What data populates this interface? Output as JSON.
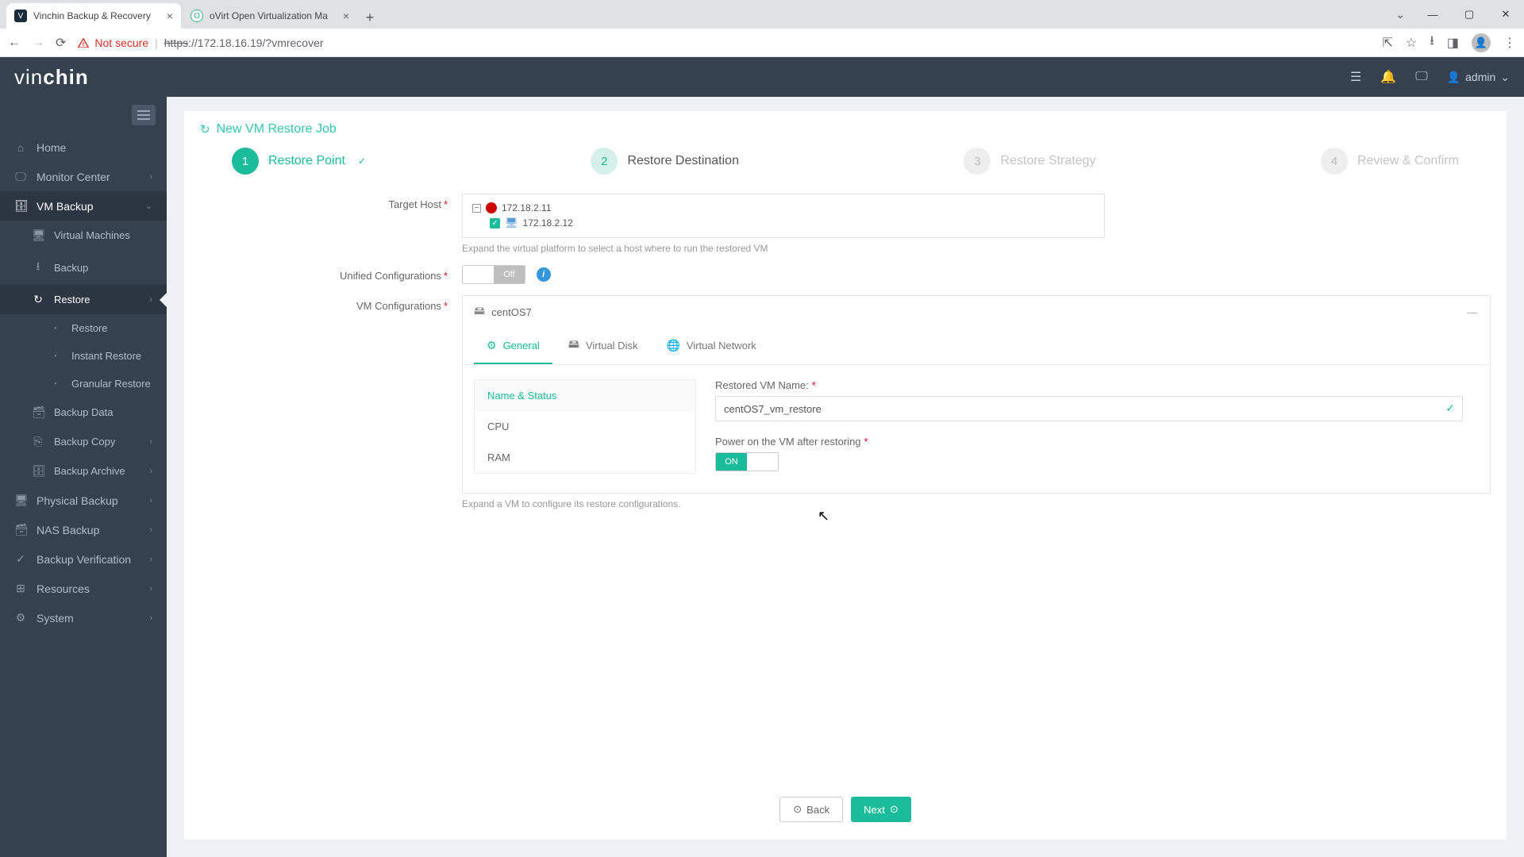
{
  "browser": {
    "tabs": [
      {
        "title": "Vinchin Backup & Recovery",
        "fav": "V",
        "active": true
      },
      {
        "title": "oVirt Open Virtualization Ma",
        "fav": "O",
        "active": false
      }
    ],
    "not_secure": "Not secure",
    "url_proto": "https",
    "url_rest": "://172.18.16.19/?vmrecover",
    "wc_min": "—",
    "wc_max": "▢",
    "wc_close": "✕",
    "wc_chev": "⌄"
  },
  "header": {
    "logo1": "vin",
    "logo2": "chin",
    "admin": "admin"
  },
  "sidebar": {
    "items": [
      {
        "icon": "⌂",
        "label": "Home"
      },
      {
        "icon": "🖵",
        "label": "Monitor Center",
        "chev": true
      },
      {
        "icon": "🗄",
        "label": "VM Backup",
        "chev": true,
        "open": true
      },
      {
        "icon": "",
        "label": "Virtual Machines",
        "lvl": 2
      },
      {
        "icon": "",
        "label": "Backup",
        "lvl": 2
      },
      {
        "icon": "",
        "label": "Restore",
        "lvl": 2,
        "chev": true,
        "active": true
      },
      {
        "icon": "",
        "label": "Restore",
        "lvl": 3
      },
      {
        "icon": "",
        "label": "Instant Restore",
        "lvl": 3
      },
      {
        "icon": "",
        "label": "Granular Restore",
        "lvl": 3
      },
      {
        "icon": "",
        "label": "Backup Data",
        "lvl": 2
      },
      {
        "icon": "",
        "label": "Backup Copy",
        "lvl": 2,
        "chev": true
      },
      {
        "icon": "",
        "label": "Backup Archive",
        "lvl": 2,
        "chev": true
      },
      {
        "icon": "🖥",
        "label": "Physical Backup",
        "chev": true
      },
      {
        "icon": "🗃",
        "label": "NAS Backup",
        "chev": true
      },
      {
        "icon": "✓",
        "label": "Backup Verification",
        "chev": true
      },
      {
        "icon": "⊞",
        "label": "Resources",
        "chev": true
      },
      {
        "icon": "⚙",
        "label": "System",
        "chev": true
      }
    ]
  },
  "page": {
    "title": "New VM Restore Job",
    "steps": [
      {
        "n": "1",
        "label": "Restore Point",
        "state": "done"
      },
      {
        "n": "2",
        "label": "Restore Destination",
        "state": "curr"
      },
      {
        "n": "3",
        "label": "Restore Strategy",
        "state": "todo"
      },
      {
        "n": "4",
        "label": "Review & Confirm",
        "state": "todo"
      }
    ],
    "target_host_label": "Target Host",
    "tree": {
      "root": "172.18.2.11",
      "child": "172.18.2.12"
    },
    "target_helper": "Expand the virtual platform to select a host where to run the restored VM",
    "unified_label": "Unified Configurations",
    "unified_off": "Off",
    "vmconf_label": "VM Configurations",
    "vm_name": "centOS7",
    "tabs": {
      "general": "General",
      "vdisk": "Virtual Disk",
      "vnet": "Virtual Network"
    },
    "sidelist": {
      "name_status": "Name & Status",
      "cpu": "CPU",
      "ram": "RAM"
    },
    "restored_name_label": "Restored VM Name:",
    "restored_name_value": "centOS7_vm_restore",
    "power_on_label": "Power on the VM after restoring",
    "power_on": "ON",
    "vm_helper": "Expand a VM to configure its restore configurations.",
    "back": "Back",
    "next": "Next"
  }
}
